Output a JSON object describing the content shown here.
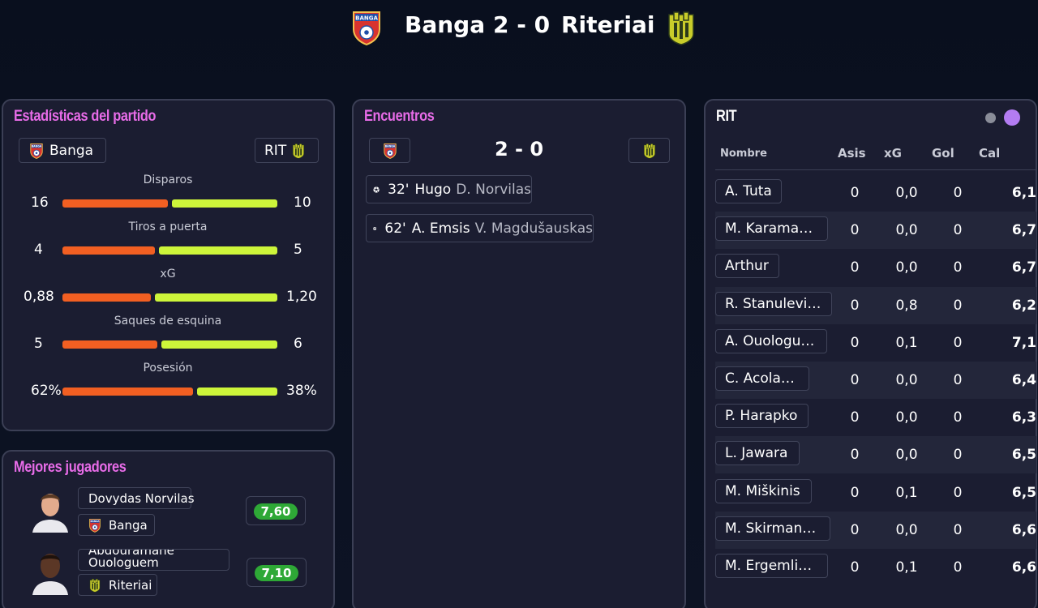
{
  "match": {
    "home_team": "Banga",
    "away_team": "Riteriai",
    "score": "2 - 0"
  },
  "colors": {
    "home_bar": "#f25f22",
    "away_bar": "#cdf53a",
    "title_accent": "#e86ce8",
    "rating_good": "#2ea836"
  },
  "stats": {
    "title": "Estadísticas del partido",
    "home_label": "Banga",
    "away_label": "RIT",
    "rows": [
      {
        "label": "Disparos",
        "home": "16",
        "away": "10",
        "home_share": 0.5,
        "away_share": 0.5
      },
      {
        "label": "Tiros a puerta",
        "home": "4",
        "away": "5",
        "home_share": 0.44,
        "away_share": 0.56
      },
      {
        "label": "xG",
        "home": "0,88",
        "away": "1,20",
        "home_share": 0.42,
        "away_share": 0.58
      },
      {
        "label": "Saques de esquina",
        "home": "5",
        "away": "6",
        "home_share": 0.45,
        "away_share": 0.55
      },
      {
        "label": "Posesión",
        "home": "62%",
        "away": "38%",
        "home_share": 0.62,
        "away_share": 0.38
      }
    ]
  },
  "best_players": {
    "title": "Mejores jugadores",
    "players": [
      {
        "name": "Dovydas Norvilas",
        "team": "Banga",
        "rating": "7,60"
      },
      {
        "name": "Abdouramane Ouologuem",
        "team": "Riteriai",
        "rating": "7,10"
      }
    ]
  },
  "events": {
    "title": "Encuentros",
    "score": "2 - 0",
    "goals": [
      {
        "minute": "32'",
        "scorer": "Hugo",
        "assist": "D. Norvilas",
        "icon": "soccer-ball-icon"
      },
      {
        "minute": "62'",
        "scorer": "A. Emsis",
        "assist": "V. Magdušauskas",
        "icon": "soccer-ball-icon"
      }
    ]
  },
  "lineup": {
    "title": "RIT",
    "headers": {
      "name": "Nombre",
      "assists": "Asis",
      "xg": "xG",
      "goals": "Gol",
      "rating": "Cal"
    },
    "players": [
      {
        "name": "A. Tuta",
        "assists": "0",
        "xg": "0,0",
        "goals": "0",
        "rating": "6,1"
      },
      {
        "name": "M. Karamarko",
        "assists": "0",
        "xg": "0,0",
        "goals": "0",
        "rating": "6,7"
      },
      {
        "name": "Arthur",
        "assists": "0",
        "xg": "0,0",
        "goals": "0",
        "rating": "6,7"
      },
      {
        "name": "R. Stanulevičius",
        "assists": "0",
        "xg": "0,8",
        "goals": "0",
        "rating": "6,2"
      },
      {
        "name": "A. Ouologuem",
        "assists": "0",
        "xg": "0,1",
        "goals": "0",
        "rating": "7,1"
      },
      {
        "name": "C. Acolatse",
        "assists": "0",
        "xg": "0,0",
        "goals": "0",
        "rating": "6,4"
      },
      {
        "name": "P. Harapko",
        "assists": "0",
        "xg": "0,0",
        "goals": "0",
        "rating": "6,3"
      },
      {
        "name": "L. Jawara",
        "assists": "0",
        "xg": "0,0",
        "goals": "0",
        "rating": "6,5"
      },
      {
        "name": "M. Miškinis",
        "assists": "0",
        "xg": "0,1",
        "goals": "0",
        "rating": "6,5"
      },
      {
        "name": "M. Skirmantas",
        "assists": "0",
        "xg": "0,0",
        "goals": "0",
        "rating": "6,6"
      },
      {
        "name": "M. Ergemlidze",
        "assists": "0",
        "xg": "0,1",
        "goals": "0",
        "rating": "6,6"
      }
    ]
  }
}
